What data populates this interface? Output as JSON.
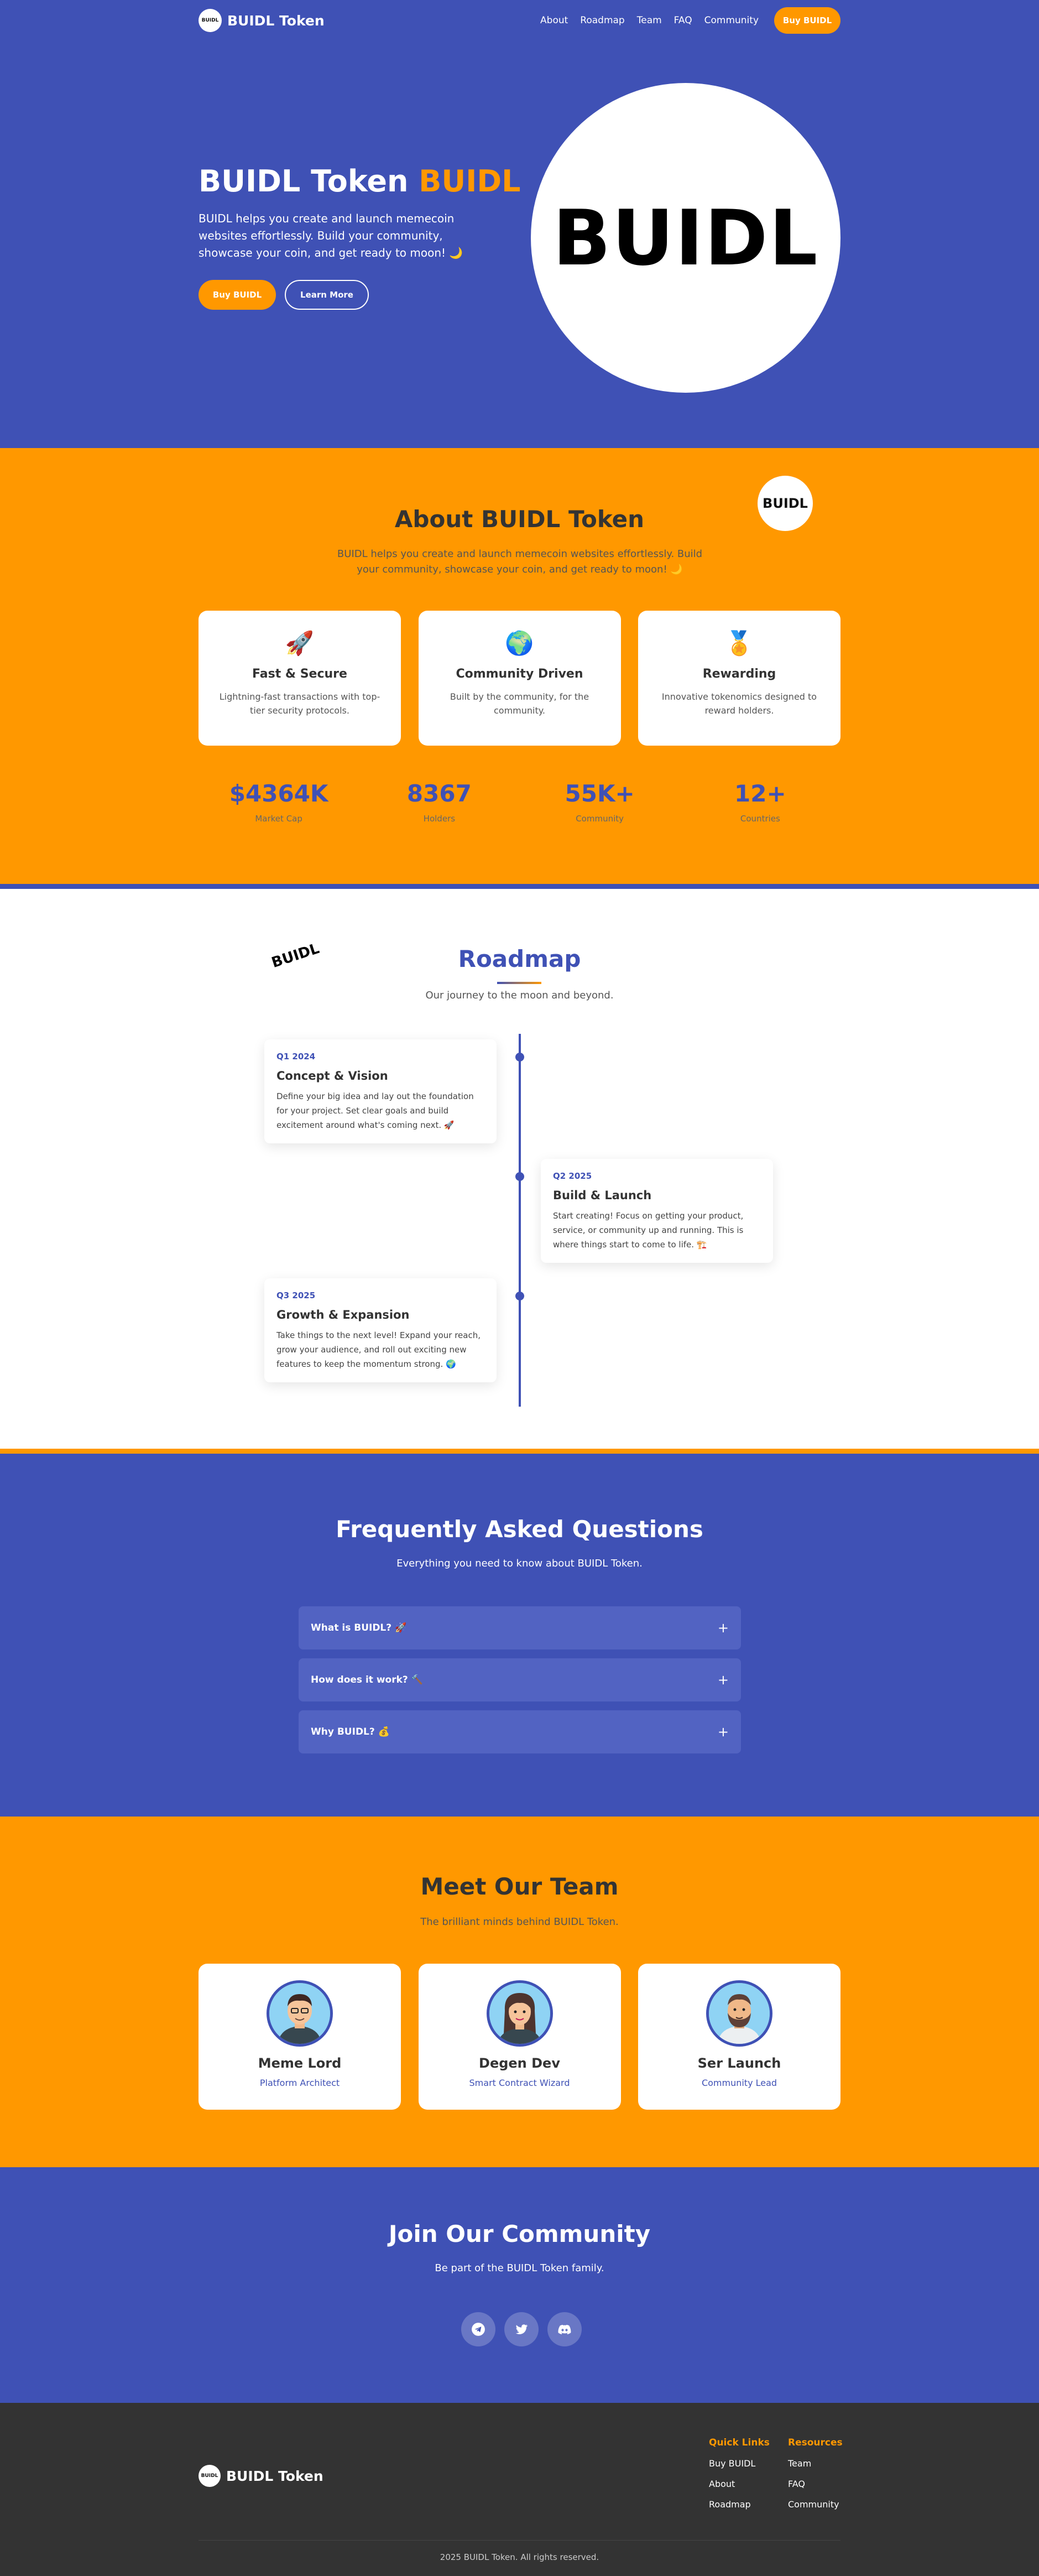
{
  "nav": {
    "logo_text": "BUIDL",
    "brand": "BUIDL Token",
    "links": [
      "About",
      "Roadmap",
      "Team",
      "FAQ",
      "Community"
    ],
    "cta": "Buy BUIDL"
  },
  "hero": {
    "title_main": "BUIDL Token",
    "title_accent": "BUIDL",
    "text": "BUIDL helps you create and launch memecoin websites effortlessly. Build your community, showcase your coin, and get ready to moon! 🌙",
    "primary_button": "Buy BUIDL",
    "secondary_button": "Learn More",
    "circle_text": "BUIDL"
  },
  "about": {
    "badge": "BUIDL",
    "title": "About BUIDL Token",
    "text": "BUIDL helps you create and launch memecoin websites effortlessly. Build your community, showcase your coin, and get ready to moon! 🌙",
    "features": [
      {
        "icon": "🚀",
        "title": "Fast & Secure",
        "desc": "Lightning-fast transactions with top-tier security protocols."
      },
      {
        "icon": "🌍",
        "title": "Community Driven",
        "desc": "Built by the community, for the community."
      },
      {
        "icon": "🏅",
        "title": "Rewarding",
        "desc": "Innovative tokenomics designed to reward holders."
      }
    ],
    "stats": [
      {
        "value": "$4364K",
        "label": "Market Cap"
      },
      {
        "value": "8367",
        "label": "Holders"
      },
      {
        "value": "55K+",
        "label": "Community"
      },
      {
        "value": "12+",
        "label": "Countries"
      }
    ]
  },
  "roadmap": {
    "logo": "BUIDL",
    "title": "Roadmap",
    "subtitle": "Our journey to the moon and beyond.",
    "items": [
      {
        "quarter": "Q1 2024",
        "title": "Concept & Vision",
        "desc": "Define your big idea and lay out the foundation for your project. Set clear goals and build excitement around what's coming next. 🚀"
      },
      {
        "quarter": "Q2 2025",
        "title": "Build & Launch",
        "desc": "Start creating! Focus on getting your product, service, or community up and running. This is where things start to come to life. 🏗️"
      },
      {
        "quarter": "Q3 2025",
        "title": "Growth & Expansion",
        "desc": "Take things to the next level! Expand your reach, grow your audience, and roll out exciting new features to keep the momentum strong. 🌍"
      }
    ]
  },
  "faq": {
    "title": "Frequently Asked Questions",
    "subtitle": "Everything you need to know about BUIDL Token.",
    "items": [
      "What is BUIDL? 🚀",
      "How does it work? 🔨",
      "Why BUIDL? 💰"
    ],
    "toggle": "+"
  },
  "team": {
    "title": "Meet Our Team",
    "subtitle": "The brilliant minds behind BUIDL Token.",
    "members": [
      {
        "name": "Meme Lord",
        "role": "Platform Architect"
      },
      {
        "name": "Degen Dev",
        "role": "Smart Contract Wizard"
      },
      {
        "name": "Ser Launch",
        "role": "Community Lead"
      }
    ]
  },
  "community": {
    "title": "Join Our Community",
    "subtitle": "Be part of the BUIDL Token family.",
    "socials": [
      "telegram-icon",
      "twitter-icon",
      "discord-icon"
    ]
  },
  "footer": {
    "brand": "BUIDL Token",
    "logo_text": "BUIDL",
    "quick_links_title": "Quick Links",
    "quick_links": [
      "Buy BUIDL",
      "About",
      "Roadmap"
    ],
    "resources_title": "Resources",
    "resources": [
      "Team",
      "FAQ",
      "Community"
    ],
    "copyright": "2025 BUIDL Token. All rights reserved."
  },
  "colors": {
    "primary": "#3f51b5",
    "accent": "#ff9800",
    "footer": "#333333"
  }
}
